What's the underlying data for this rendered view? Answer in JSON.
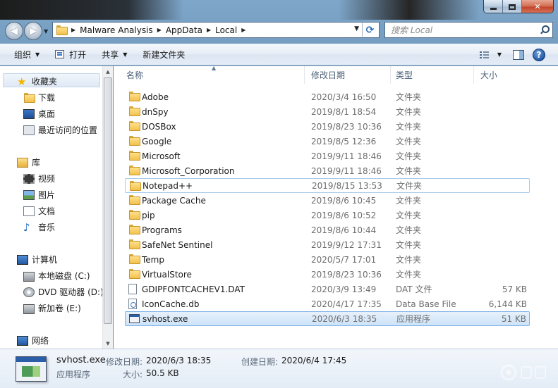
{
  "window": {
    "controls": {
      "minimize": "",
      "maximize": "",
      "close": "✕"
    }
  },
  "nav": {
    "back_icon": "back-arrow-icon",
    "forward_icon": "forward-arrow-icon",
    "breadcrumbs": [
      "Malware Analysis",
      "AppData",
      "Local"
    ],
    "search_placeholder": "搜索 Local"
  },
  "toolbar": {
    "organize": "组织",
    "open": "打开",
    "share": "共享",
    "new_folder": "新建文件夹"
  },
  "sidebar": {
    "favorites": {
      "label": "收藏夹",
      "items": [
        "下载",
        "桌面",
        "最近访问的位置"
      ]
    },
    "libraries": {
      "label": "库",
      "items": [
        "视频",
        "图片",
        "文档",
        "音乐"
      ]
    },
    "computer": {
      "label": "计算机",
      "items": [
        "本地磁盘 (C:)",
        "DVD 驱动器 (D:)",
        "新加卷 (E:)"
      ]
    },
    "network": {
      "label": "网络"
    }
  },
  "columns": {
    "name": "名称",
    "date": "修改日期",
    "type": "类型",
    "size": "大小"
  },
  "files": [
    {
      "name": "Adobe",
      "date": "2020/3/4 16:50",
      "type": "文件夹",
      "size": "",
      "kind": "folder"
    },
    {
      "name": "dnSpy",
      "date": "2019/8/1 18:54",
      "type": "文件夹",
      "size": "",
      "kind": "folder"
    },
    {
      "name": "DOSBox",
      "date": "2019/8/23 10:36",
      "type": "文件夹",
      "size": "",
      "kind": "folder"
    },
    {
      "name": "Google",
      "date": "2019/8/5 12:36",
      "type": "文件夹",
      "size": "",
      "kind": "folder"
    },
    {
      "name": "Microsoft",
      "date": "2019/9/11 18:46",
      "type": "文件夹",
      "size": "",
      "kind": "folder"
    },
    {
      "name": "Microsoft_Corporation",
      "date": "2019/9/11 18:46",
      "type": "文件夹",
      "size": "",
      "kind": "folder"
    },
    {
      "name": "Notepad++",
      "date": "2019/8/15 13:53",
      "type": "文件夹",
      "size": "",
      "kind": "folder",
      "state": "hover"
    },
    {
      "name": "Package Cache",
      "date": "2019/8/6 10:45",
      "type": "文件夹",
      "size": "",
      "kind": "folder"
    },
    {
      "name": "pip",
      "date": "2019/8/6 10:52",
      "type": "文件夹",
      "size": "",
      "kind": "folder"
    },
    {
      "name": "Programs",
      "date": "2019/8/6 10:44",
      "type": "文件夹",
      "size": "",
      "kind": "folder"
    },
    {
      "name": "SafeNet Sentinel",
      "date": "2019/9/12 17:31",
      "type": "文件夹",
      "size": "",
      "kind": "folder"
    },
    {
      "name": "Temp",
      "date": "2020/5/7 17:01",
      "type": "文件夹",
      "size": "",
      "kind": "folder"
    },
    {
      "name": "VirtualStore",
      "date": "2019/8/23 10:36",
      "type": "文件夹",
      "size": "",
      "kind": "folder"
    },
    {
      "name": "GDIPFONTCACHEV1.DAT",
      "date": "2020/3/9 13:49",
      "type": "DAT 文件",
      "size": "57 KB",
      "kind": "dat"
    },
    {
      "name": "IconCache.db",
      "date": "2020/4/17 17:35",
      "type": "Data Base File",
      "size": "6,144 KB",
      "kind": "db"
    },
    {
      "name": "svhost.exe",
      "date": "2020/6/3 18:35",
      "type": "应用程序",
      "size": "51 KB",
      "kind": "exe",
      "state": "selected"
    }
  ],
  "details": {
    "filename": "svhost.exe",
    "filetype": "应用程序",
    "modified_label": "修改日期:",
    "modified_value": "2020/6/3 18:35",
    "size_label": "大小:",
    "size_value": "50.5 KB",
    "created_label": "创建日期:",
    "created_value": "2020/6/4 17:45"
  },
  "colors": {
    "selection_border": "#7eb4ea",
    "hover_border": "#a9cbea",
    "header_text": "#4c607a"
  }
}
